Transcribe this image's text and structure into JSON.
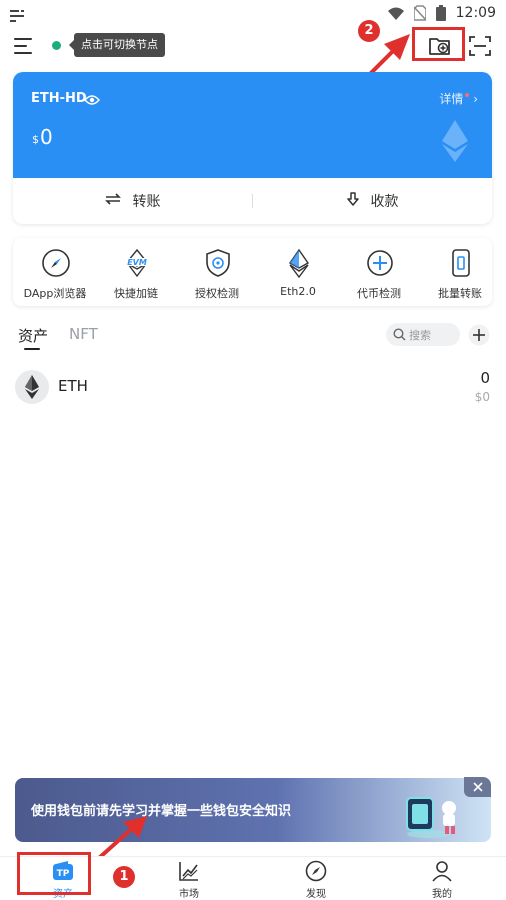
{
  "status_bar": {
    "time": "12:09"
  },
  "header": {
    "node_tooltip": "点击可切换节点"
  },
  "wallet": {
    "name": "ETH-HD",
    "detail_label": "详情",
    "currency_symbol": "$",
    "balance": "0",
    "transfer_label": "转账",
    "receive_label": "收款"
  },
  "tools": [
    {
      "label": "DApp浏览器",
      "icon": "compass-icon"
    },
    {
      "label": "快捷加链",
      "icon": "evm-icon"
    },
    {
      "label": "授权检测",
      "icon": "shield-icon"
    },
    {
      "label": "Eth2.0",
      "icon": "eth-icon"
    },
    {
      "label": "代币检测",
      "icon": "token-check-icon"
    },
    {
      "label": "批量转账",
      "icon": "batch-transfer-icon"
    }
  ],
  "assets": {
    "tab_assets": "资产",
    "tab_nft": "NFT",
    "search_placeholder": "搜索",
    "tokens": [
      {
        "symbol": "ETH",
        "amount": "0",
        "value": "$0"
      }
    ]
  },
  "banner": {
    "text": "使用钱包前请先学习并掌握一些钱包安全知识"
  },
  "annotations": {
    "badge1": "1",
    "badge2": "2"
  },
  "colors": {
    "brand_blue": "#2a8ff5",
    "node_green": "#1aae7a",
    "annotation_red": "#e0302e"
  },
  "nav": [
    {
      "label": "资产",
      "icon": "wallet-icon"
    },
    {
      "label": "市场",
      "icon": "market-icon"
    },
    {
      "label": "发现",
      "icon": "discover-icon"
    },
    {
      "label": "我的",
      "icon": "profile-icon"
    }
  ]
}
